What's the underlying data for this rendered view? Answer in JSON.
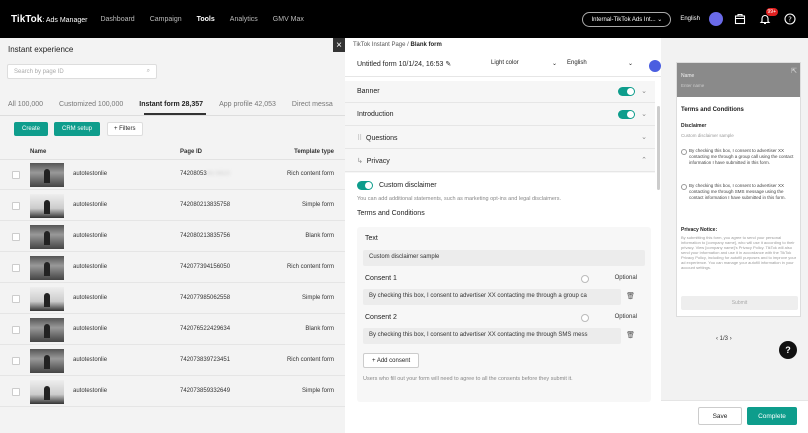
{
  "topbar": {
    "logo": "TikTok",
    "logo_sub": ": Ads Manager",
    "nav": [
      "Dashboard",
      "Campaign",
      "Tools",
      "Analytics",
      "GMV Max"
    ],
    "active_nav": "Tools",
    "account": "Internal-TikTok Ads Int...",
    "language": "English",
    "notification_count": "99+"
  },
  "left": {
    "title": "Instant experience",
    "search_placeholder": "Search by page ID",
    "tabs": [
      "All 100,000",
      "Customized 100,000",
      "Instant form 28,357",
      "App profile 42,053",
      "Direct messa"
    ],
    "active_tab": "Instant form 28,357",
    "create_label": "Create",
    "crm_label": "CRM setup",
    "filters_label": "+ Filters",
    "columns": {
      "name": "Name",
      "page_id": "Page ID",
      "template": "Template type"
    },
    "rows": [
      {
        "name": "autotestonlie",
        "id": "74208053",
        "id_blur": "4478920",
        "type": "Rich content form",
        "thumb": "dark"
      },
      {
        "name": "autotestonlie",
        "id": "742080213835758",
        "id_blur": "",
        "type": "Simple form",
        "thumb": "white"
      },
      {
        "name": "autotestonlie",
        "id": "742080213835756",
        "id_blur": "",
        "type": "Blank form",
        "thumb": "dark"
      },
      {
        "name": "autotestonlie",
        "id": "742077394156050",
        "id_blur": "",
        "type": "Rich content form",
        "thumb": "dark"
      },
      {
        "name": "autotestonlie",
        "id": "742077985062558",
        "id_blur": "",
        "type": "Simple form",
        "thumb": "white"
      },
      {
        "name": "autotestonlie",
        "id": "742076522429634",
        "id_blur": "",
        "type": "Blank form",
        "thumb": "dark"
      },
      {
        "name": "autotestonlie",
        "id": "742073839723451",
        "id_blur": "",
        "type": "Rich content form",
        "thumb": "dark"
      },
      {
        "name": "autotestonlie",
        "id": "742073859332649",
        "id_blur": "",
        "type": "Simple form",
        "thumb": "white"
      }
    ]
  },
  "editor": {
    "breadcrumb_parent": "TikTok Instant Page",
    "breadcrumb_sep": "/",
    "breadcrumb_current": "Blank form",
    "form_title": "Untitled form 10/1/24, 16:53",
    "theme": "Light color",
    "language": "English",
    "sections": {
      "banner": "Banner",
      "introduction": "Introduction",
      "questions": "Questions",
      "privacy": "Privacy"
    },
    "privacy": {
      "custom_disclaimer": "Custom disclaimer",
      "disclaimer_help": "You can add additional statements, such as marketing opt-ins and legal disclaimers.",
      "tc_label": "Terms and Conditions",
      "text_label": "Text",
      "text_value": "Custom disclaimer sample",
      "consent1_label": "Consent 1",
      "consent1_value": "By checking this box, I consent to advertiser XX contacting me through a group ca",
      "consent2_label": "Consent 2",
      "consent2_value": "By checking this box, I consent to advertiser XX contacting me through SMS mess",
      "optional": "Optional",
      "add_consent": "+ Add consent",
      "footer_note": "Users who fill out your form will need to agree to all the consents before they submit it."
    }
  },
  "preview": {
    "name_label": "Name",
    "name_placeholder": "Enter name",
    "tc_title": "Terms and Conditions",
    "disclaimer_title": "Disclaimer",
    "disclaimer_text": "Custom disclaimer sample",
    "consent1": "By checking this box, I consent to advertiser XX contacting me through a group call using the contact information I have submitted in this form.",
    "consent2": "By checking this box, I consent to advertiser XX contacting me through SMS message using the contact information I have submitted in this form.",
    "privacy_title": "Privacy Notice:",
    "privacy_text": "By submitting this form, you agree to send your personal information to [company name], who will use it according to their privacy. View [company name]'s Privacy Policy. TikTok will also send your information and use it in accordance with the TikTok Privacy Policy, including for autofill purposes and to improve your ad experience. You can manage your autofill information in your account settings.",
    "submit": "Submit",
    "pagination": "1/3",
    "help": "?"
  },
  "footer": {
    "save": "Save",
    "complete": "Complete"
  }
}
